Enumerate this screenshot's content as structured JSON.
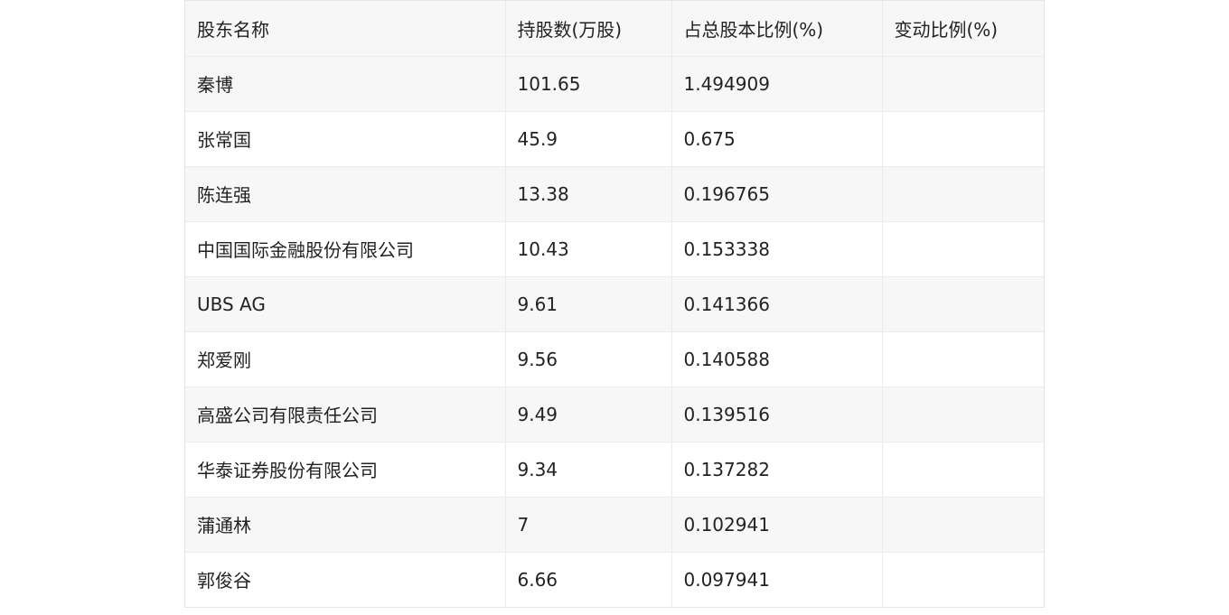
{
  "table": {
    "headers": [
      "股东名称",
      "持股数(万股)",
      "占总股本比例(%)",
      "变动比例(%)"
    ],
    "rows": [
      [
        "秦博",
        "101.65",
        "1.494909",
        ""
      ],
      [
        "张常国",
        "45.9",
        "0.675",
        ""
      ],
      [
        "陈连强",
        "13.38",
        "0.196765",
        ""
      ],
      [
        "中国国际金融股份有限公司",
        "10.43",
        "0.153338",
        ""
      ],
      [
        "UBS AG",
        "9.61",
        "0.141366",
        ""
      ],
      [
        "郑爱刚",
        "9.56",
        "0.140588",
        ""
      ],
      [
        "高盛公司有限责任公司",
        "9.49",
        "0.139516",
        ""
      ],
      [
        "华泰证券股份有限公司",
        "9.34",
        "0.137282",
        ""
      ],
      [
        "蒲通林",
        "7",
        "0.102941",
        ""
      ],
      [
        "郭俊谷",
        "6.66",
        "0.097941",
        ""
      ]
    ]
  }
}
